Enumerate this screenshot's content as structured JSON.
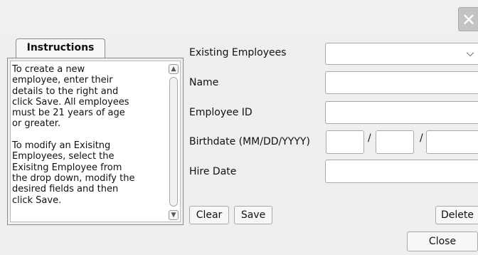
{
  "window": {
    "close_icon": "close-icon"
  },
  "instructions": {
    "tab_label": "Instructions",
    "text": "To create a new\nemployee, enter their\ndetails to the right and\nclick Save. All employees\nmust be 21 years of age\nor greater.\n\nTo modify an Exisitng\nEmployees, select the\nExisitng Employee from\nthe drop down, modify the\ndesired fields and then\nclick Save."
  },
  "form": {
    "existing_employees_label": "Existing Employees",
    "existing_employees_value": "",
    "name_label": "Name",
    "name_value": "",
    "employee_id_label": "Employee ID",
    "employee_id_value": "",
    "birthdate_label": "Birthdate (MM/DD/YYYY)",
    "birthdate_separator": "/",
    "hire_date_label": "Hire Date",
    "hire_date_value": ""
  },
  "buttons": {
    "clear": "Clear",
    "save": "Save",
    "delete": "Delete",
    "close": "Close"
  }
}
